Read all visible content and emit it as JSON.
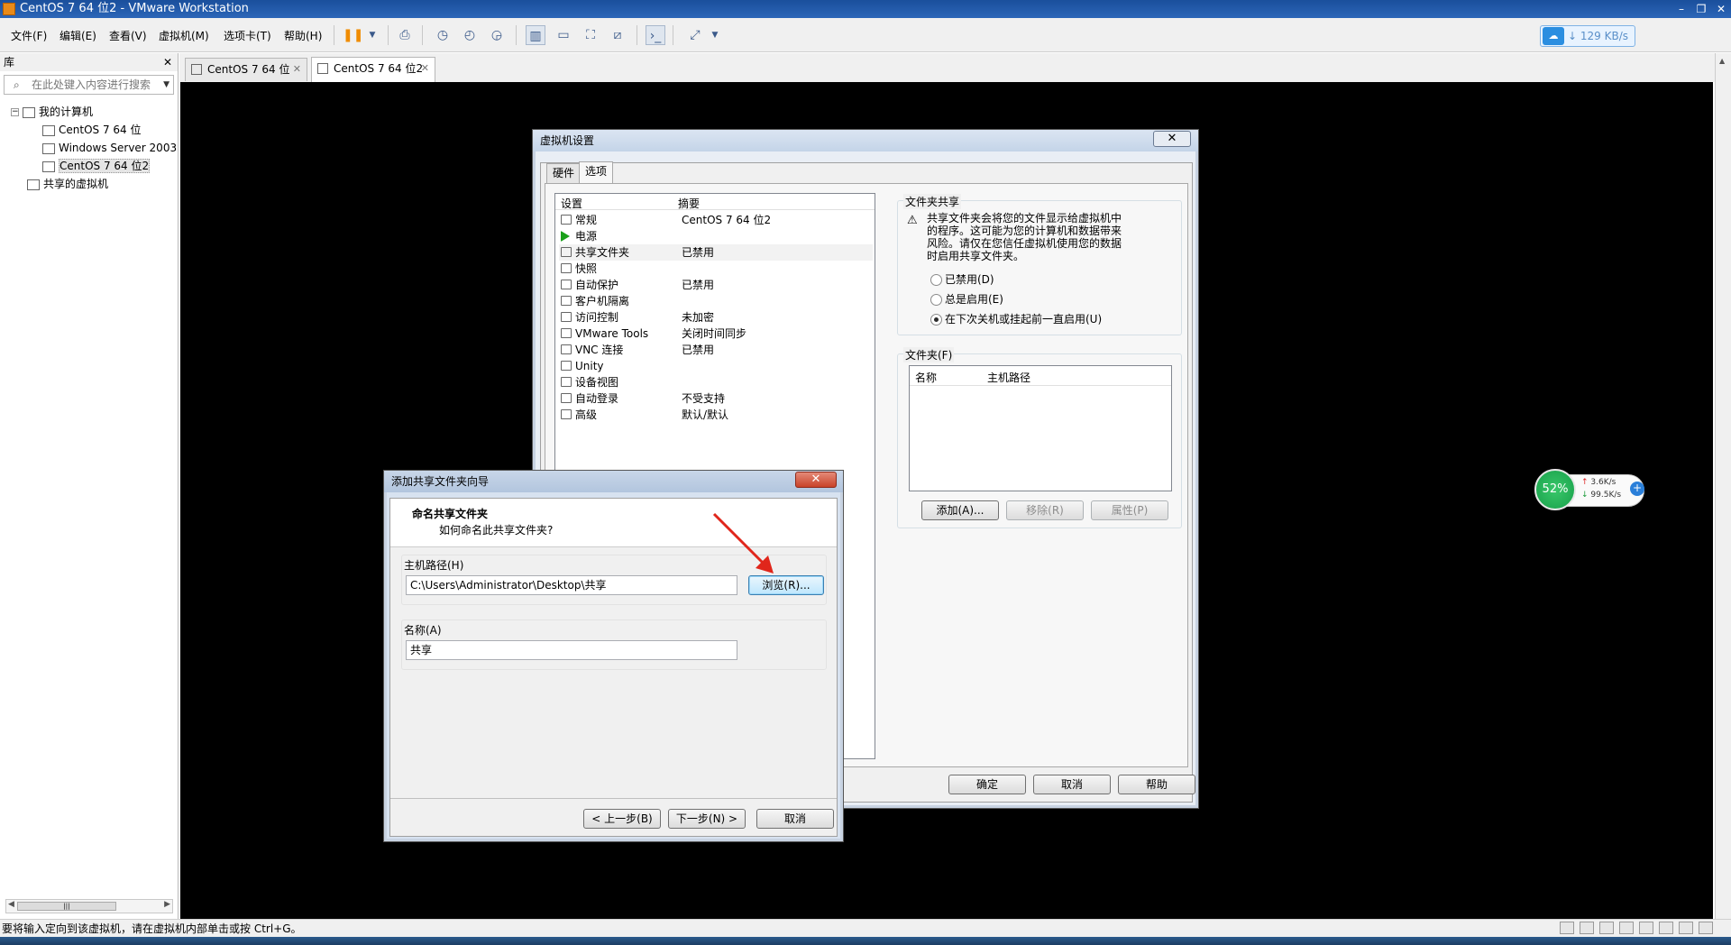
{
  "window": {
    "title": "CentOS 7 64 位2 - VMware Workstation"
  },
  "menu": [
    "文件(F)",
    "编辑(E)",
    "查看(V)",
    "虚拟机(M)",
    "选项卡(T)",
    "帮助(H)"
  ],
  "net_widget": {
    "speed": "129 KB/s"
  },
  "library": {
    "title": "库",
    "search_placeholder": "在此处键入内容进行搜索",
    "tree": {
      "root": "我的计算机",
      "vms": [
        "CentOS 7 64 位",
        "Windows Server 2003",
        "CentOS 7 64 位2"
      ],
      "shared": "共享的虚拟机"
    }
  },
  "tabs": [
    "CentOS 7 64 位",
    "CentOS 7 64 位2"
  ],
  "settings_dialog": {
    "title": "虚拟机设置",
    "tabs": [
      "硬件",
      "选项"
    ],
    "list_headers": [
      "设置",
      "摘要"
    ],
    "rows": [
      {
        "name": "常规",
        "value": "CentOS 7 64 位2"
      },
      {
        "name": "电源",
        "value": ""
      },
      {
        "name": "共享文件夹",
        "value": "已禁用"
      },
      {
        "name": "快照",
        "value": ""
      },
      {
        "name": "自动保护",
        "value": "已禁用"
      },
      {
        "name": "客户机隔离",
        "value": ""
      },
      {
        "name": "访问控制",
        "value": "未加密"
      },
      {
        "name": "VMware Tools",
        "value": "关闭时间同步"
      },
      {
        "name": "VNC 连接",
        "value": "已禁用"
      },
      {
        "name": "Unity",
        "value": ""
      },
      {
        "name": "设备视图",
        "value": ""
      },
      {
        "name": "自动登录",
        "value": "不受支持"
      },
      {
        "name": "高级",
        "value": "默认/默认"
      }
    ],
    "sharing": {
      "group_title": "文件夹共享",
      "warning_lines": [
        "共享文件夹会将您的文件显示给虚拟机中",
        "的程序。这可能为您的计算机和数据带来",
        "风险。请仅在您信任虚拟机使用您的数据",
        "时启用共享文件夹。"
      ],
      "options": [
        "已禁用(D)",
        "总是启用(E)",
        "在下次关机或挂起前一直启用(U)"
      ],
      "selected_index": 2
    },
    "folders": {
      "group_title": "文件夹(F)",
      "columns": [
        "名称",
        "主机路径"
      ],
      "add": "添加(A)...",
      "remove": "移除(R)",
      "properties": "属性(P)"
    },
    "buttons": {
      "ok": "确定",
      "cancel": "取消",
      "help": "帮助"
    }
  },
  "wizard": {
    "title": "添加共享文件夹向导",
    "heading": "命名共享文件夹",
    "subheading": "如何命名此共享文件夹?",
    "host_path_label": "主机路径(H)",
    "host_path_value": "C:\\Users\\Administrator\\Desktop\\共享",
    "browse": "浏览(R)...",
    "name_label": "名称(A)",
    "name_value": "共享",
    "back": "< 上一步(B)",
    "next": "下一步(N) >",
    "cancel": "取消"
  },
  "speed_widget": {
    "percent": "52%",
    "up": "3.6K/s",
    "down": "99.5K/s"
  },
  "status": {
    "message": "要将输入定向到该虚拟机，请在虚拟机内部单击或按 Ctrl+G。"
  }
}
